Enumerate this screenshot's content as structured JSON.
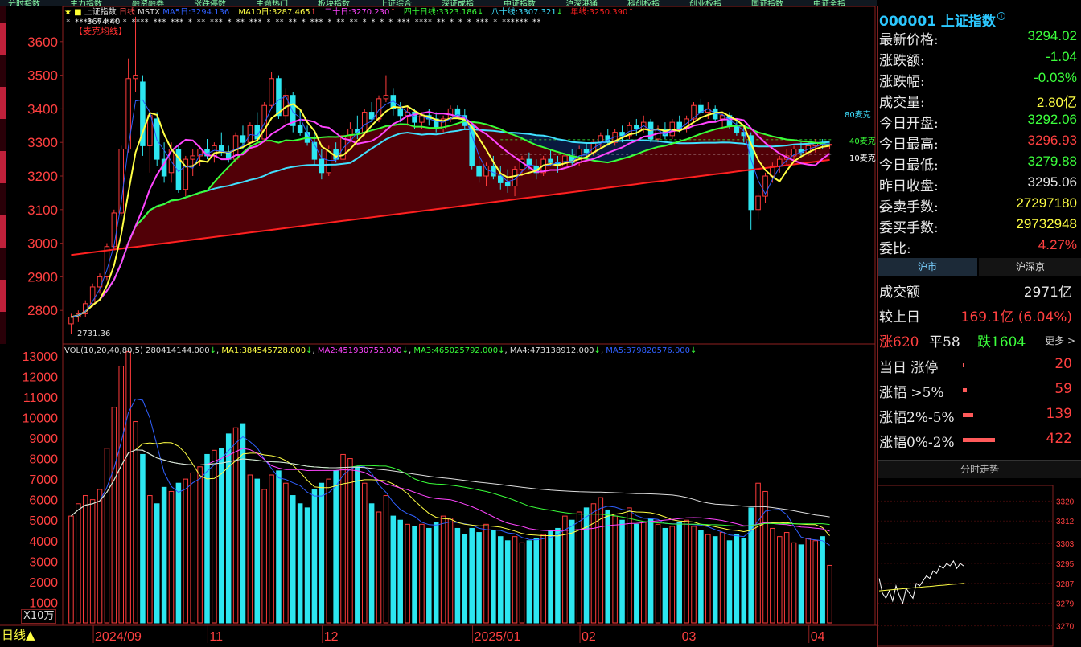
{
  "top_menu": [
    "分时指数",
    "主力指数",
    "融资融券",
    "涨跌停数",
    "主题热门",
    "板块指数",
    "上证综合",
    "深证成指",
    "中证指数",
    "沪深港通",
    "科创板指",
    "创业板指",
    "国证指数",
    "中证全指"
  ],
  "main_legend": {
    "marks": "★ ■",
    "index_name": "上证指数",
    "period": "日线",
    "indicator": "MSTX",
    "ma5_label": "MA5日:",
    "ma5_value": "3294.136",
    "ma10_label": "MA10日:",
    "ma10_value": "3287.465",
    "ma20_label": "二十日:",
    "ma20_value": "3270.230",
    "ma40_label": "四十日线:",
    "ma40_value": "3323.186",
    "ma80_label": "八十线:",
    "ma80_value": "3307.321",
    "ma250_label": "年线:",
    "ma250_value": "3250.390",
    "high_label": "3674.40",
    "sub_label": "【麦克均线】"
  },
  "annotations": {
    "low_label": "2731.36",
    "mcgann80": "80麦克",
    "mcgann40": "40麦克",
    "mcgann10": "10麦克"
  },
  "vol_legend": {
    "title": "VOL(10,20,40,80,5)",
    "vol_value": "280414144.000",
    "ma1_label": "MA1:",
    "ma1_value": "384545728.000",
    "ma2_label": "MA2:",
    "ma2_value": "451930752.000",
    "ma3_label": "MA3:",
    "ma3_value": "465025792.000",
    "ma4_label": "MA4:",
    "ma4_value": "473138912.000",
    "ma5_label": "MA5:",
    "ma5_value": "379820576.000",
    "unit": "X10万"
  },
  "period_button": "日线▲",
  "x_labels": [
    "2024/09",
    "11",
    "12",
    "2025/01",
    "02",
    "03",
    "04"
  ],
  "colors": {
    "up": "#ff3b3b",
    "down": "#2de6f0",
    "ma5": "#ffff44",
    "ma10": "#ff44ff",
    "ma20": "#39ff39",
    "ma40": "#40e0ff",
    "ma250": "#ff2020",
    "accent": "#2cc8ff",
    "green": "#3cff3c",
    "red": "#ff4040"
  },
  "chart_data": [
    {
      "type": "candlestick",
      "title": "上证指数 日线",
      "ylim": [
        2700,
        3700
      ],
      "y_ticks": [
        2800,
        2900,
        3000,
        3100,
        3200,
        3300,
        3400,
        3500,
        3600
      ],
      "levels": {
        "80": 3400,
        "40": 3308,
        "10": 3265
      },
      "ohlc": [
        [
          2760,
          2790,
          2731,
          2780
        ],
        [
          2780,
          2800,
          2765,
          2790
        ],
        [
          2790,
          2830,
          2780,
          2820
        ],
        [
          2820,
          2880,
          2810,
          2870
        ],
        [
          2870,
          2910,
          2850,
          2900
        ],
        [
          2900,
          3000,
          2890,
          2990
        ],
        [
          2990,
          3100,
          2980,
          3090
        ],
        [
          3090,
          3290,
          3080,
          3280
        ],
        [
          3280,
          3550,
          3270,
          3490
        ],
        [
          3490,
          3674,
          3450,
          3500
        ],
        [
          3480,
          3500,
          3260,
          3290
        ],
        [
          3290,
          3400,
          3210,
          3380
        ],
        [
          3370,
          3390,
          3230,
          3250
        ],
        [
          3250,
          3300,
          3180,
          3200
        ],
        [
          3210,
          3300,
          3180,
          3280
        ],
        [
          3280,
          3290,
          3150,
          3160
        ],
        [
          3160,
          3260,
          3140,
          3250
        ],
        [
          3250,
          3280,
          3200,
          3260
        ],
        [
          3260,
          3290,
          3230,
          3280
        ],
        [
          3280,
          3310,
          3250,
          3260
        ],
        [
          3260,
          3300,
          3240,
          3290
        ],
        [
          3290,
          3330,
          3260,
          3270
        ],
        [
          3270,
          3290,
          3240,
          3250
        ],
        [
          3250,
          3330,
          3240,
          3320
        ],
        [
          3320,
          3350,
          3280,
          3300
        ],
        [
          3300,
          3360,
          3290,
          3350
        ],
        [
          3350,
          3390,
          3300,
          3310
        ],
        [
          3310,
          3420,
          3300,
          3410
        ],
        [
          3410,
          3510,
          3400,
          3490
        ],
        [
          3490,
          3500,
          3370,
          3380
        ],
        [
          3380,
          3460,
          3350,
          3440
        ],
        [
          3440,
          3450,
          3330,
          3350
        ],
        [
          3350,
          3400,
          3320,
          3330
        ],
        [
          3330,
          3350,
          3290,
          3300
        ],
        [
          3300,
          3330,
          3230,
          3250
        ],
        [
          3250,
          3280,
          3190,
          3210
        ],
        [
          3210,
          3290,
          3200,
          3280
        ],
        [
          3280,
          3300,
          3240,
          3250
        ],
        [
          3250,
          3330,
          3240,
          3320
        ],
        [
          3320,
          3360,
          3300,
          3340
        ],
        [
          3340,
          3380,
          3310,
          3330
        ],
        [
          3330,
          3400,
          3320,
          3390
        ],
        [
          3390,
          3420,
          3360,
          3370
        ],
        [
          3370,
          3440,
          3360,
          3430
        ],
        [
          3430,
          3500,
          3420,
          3440
        ],
        [
          3440,
          3460,
          3380,
          3400
        ],
        [
          3400,
          3420,
          3360,
          3380
        ],
        [
          3380,
          3410,
          3350,
          3390
        ],
        [
          3390,
          3400,
          3340,
          3360
        ],
        [
          3360,
          3390,
          3340,
          3380
        ],
        [
          3380,
          3400,
          3350,
          3370
        ],
        [
          3370,
          3390,
          3330,
          3340
        ],
        [
          3340,
          3380,
          3330,
          3370
        ],
        [
          3370,
          3410,
          3360,
          3400
        ],
        [
          3400,
          3410,
          3370,
          3380
        ],
        [
          3380,
          3400,
          3340,
          3350
        ],
        [
          3350,
          3360,
          3220,
          3230
        ],
        [
          3230,
          3260,
          3180,
          3200
        ],
        [
          3200,
          3240,
          3170,
          3230
        ],
        [
          3230,
          3260,
          3190,
          3200
        ],
        [
          3200,
          3230,
          3160,
          3180
        ],
        [
          3180,
          3220,
          3150,
          3170
        ],
        [
          3170,
          3230,
          3140,
          3220
        ],
        [
          3220,
          3260,
          3200,
          3250
        ],
        [
          3250,
          3270,
          3220,
          3230
        ],
        [
          3230,
          3250,
          3190,
          3210
        ],
        [
          3210,
          3260,
          3200,
          3250
        ],
        [
          3250,
          3280,
          3230,
          3240
        ],
        [
          3240,
          3260,
          3210,
          3230
        ],
        [
          3230,
          3270,
          3220,
          3260
        ],
        [
          3260,
          3280,
          3230,
          3240
        ],
        [
          3240,
          3290,
          3230,
          3280
        ],
        [
          3280,
          3300,
          3250,
          3270
        ],
        [
          3270,
          3310,
          3260,
          3300
        ],
        [
          3300,
          3330,
          3280,
          3320
        ],
        [
          3320,
          3340,
          3290,
          3300
        ],
        [
          3300,
          3340,
          3290,
          3330
        ],
        [
          3330,
          3350,
          3300,
          3320
        ],
        [
          3320,
          3360,
          3310,
          3350
        ],
        [
          3350,
          3370,
          3320,
          3340
        ],
        [
          3340,
          3380,
          3330,
          3360
        ],
        [
          3360,
          3370,
          3300,
          3310
        ],
        [
          3310,
          3350,
          3300,
          3340
        ],
        [
          3340,
          3360,
          3310,
          3320
        ],
        [
          3320,
          3370,
          3310,
          3360
        ],
        [
          3360,
          3380,
          3330,
          3340
        ],
        [
          3340,
          3380,
          3330,
          3370
        ],
        [
          3370,
          3420,
          3360,
          3410
        ],
        [
          3410,
          3430,
          3380,
          3390
        ],
        [
          3390,
          3420,
          3370,
          3400
        ],
        [
          3400,
          3410,
          3360,
          3370
        ],
        [
          3370,
          3390,
          3340,
          3380
        ],
        [
          3380,
          3390,
          3340,
          3350
        ],
        [
          3350,
          3370,
          3320,
          3330
        ],
        [
          3330,
          3350,
          3300,
          3320
        ],
        [
          3320,
          3330,
          3040,
          3100
        ],
        [
          3100,
          3150,
          3070,
          3140
        ],
        [
          3140,
          3210,
          3120,
          3200
        ],
        [
          3200,
          3240,
          3180,
          3230
        ],
        [
          3230,
          3260,
          3210,
          3250
        ],
        [
          3250,
          3280,
          3230,
          3260
        ],
        [
          3260,
          3290,
          3240,
          3280
        ],
        [
          3280,
          3300,
          3260,
          3270
        ],
        [
          3270,
          3300,
          3260,
          3290
        ],
        [
          3290,
          3310,
          3270,
          3300
        ],
        [
          3300,
          3310,
          3280,
          3294
        ],
        [
          3294,
          3297,
          3280,
          3294
        ]
      ],
      "volume": [
        5200,
        5800,
        6200,
        6000,
        6500,
        8500,
        10500,
        12500,
        13200,
        9800,
        8200,
        6200,
        5800,
        6600,
        6400,
        6800,
        7000,
        7300,
        7600,
        8200,
        8400,
        8500,
        9200,
        9500,
        9700,
        7200,
        7000,
        6500,
        7200,
        7400,
        6800,
        6200,
        5800,
        5600,
        6500,
        6800,
        7000,
        7400,
        8200,
        8000,
        7600,
        6800,
        5800,
        5400,
        6200,
        5200,
        5000,
        4800,
        4700,
        4800,
        4600,
        4900,
        5200,
        5100,
        4600,
        4300,
        4600,
        4400,
        4800,
        4500,
        4200,
        4000,
        4200,
        3900,
        4000,
        4100,
        4300,
        4500,
        4600,
        5200,
        5000,
        5400,
        5600,
        5800,
        6100,
        5500,
        5200,
        5000,
        5600,
        4800,
        4900,
        5100,
        4800,
        4600,
        4700,
        4900,
        5000,
        4700,
        4500,
        4300,
        4200,
        4400,
        4000,
        4300,
        4100,
        5600,
        6800,
        6400,
        4600,
        4200,
        4400,
        3900,
        3800,
        4100,
        4000,
        4200,
        2800
      ]
    },
    {
      "type": "line",
      "title": "分时走势",
      "y_ticks": [
        3270,
        3279,
        3287,
        3295,
        3303,
        3312,
        3320
      ],
      "ylim": [
        3266,
        3324
      ]
    }
  ],
  "panel": {
    "code": "000001",
    "name": "上证指数",
    "info_icon": "ⓘ",
    "quotes": [
      {
        "label": "最新价格:",
        "value": "3294.02",
        "color": "#3cff3c"
      },
      {
        "label": "涨跌额:",
        "value": "-1.04",
        "color": "#3cff3c"
      },
      {
        "label": "涨跌幅:",
        "value": "-0.03%",
        "color": "#3cff3c"
      },
      {
        "label": "成交量:",
        "value": "2.80亿",
        "color": "#ffff44"
      },
      {
        "label": "今日开盘:",
        "value": "3292.06",
        "color": "#3cff3c"
      },
      {
        "label": "今日最高:",
        "value": "3296.93",
        "color": "#ff4040"
      },
      {
        "label": "今日最低:",
        "value": "3279.88",
        "color": "#3cff3c"
      },
      {
        "label": "昨日收盘:",
        "value": "3295.06",
        "color": "#e8e8e8"
      },
      {
        "label": "委卖手数:",
        "value": "27297180",
        "color": "#ffff44"
      },
      {
        "label": "委买手数:",
        "value": "29732948",
        "color": "#ffff44"
      },
      {
        "label": "委比:",
        "value": "4.27%",
        "color": "#ff4040"
      }
    ],
    "tabs": [
      "沪市",
      "沪深京"
    ],
    "turnover_label": "成交额",
    "turnover_value": "2971亿",
    "compare_label": "较上日",
    "compare_value": "169.1亿 (6.04%)",
    "up_label": "涨620",
    "flat_label": "平58",
    "down_label": "跌1604",
    "more_label": "更多 >",
    "limit_rows": [
      {
        "label": "当日 涨停",
        "value": "20",
        "bar": 0.01
      },
      {
        "label": "涨幅 >5%",
        "value": "59",
        "bar": 0.03
      },
      {
        "label": "涨幅2%-5%",
        "value": "139",
        "bar": 0.07
      },
      {
        "label": "涨幅0%-2%",
        "value": "422",
        "bar": 0.22
      }
    ],
    "intraday_title": "分时走势"
  }
}
